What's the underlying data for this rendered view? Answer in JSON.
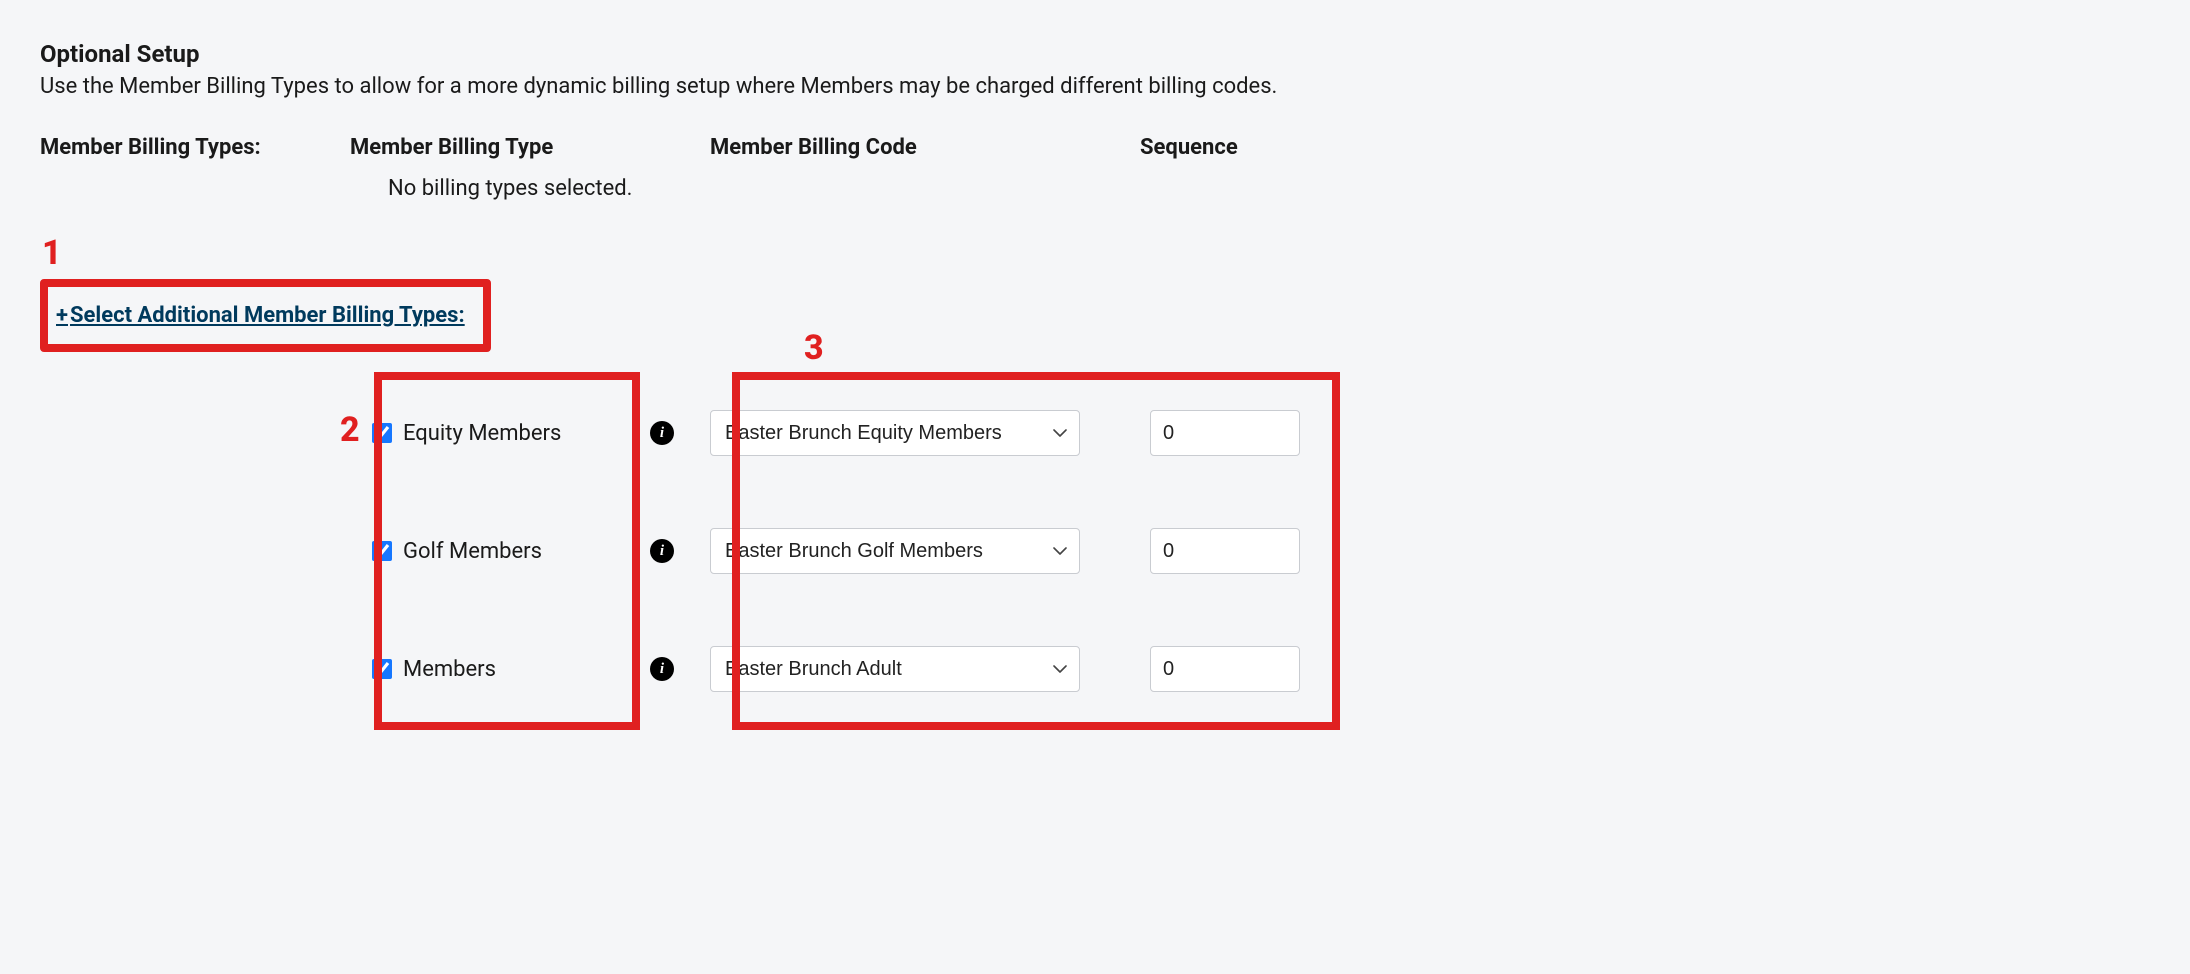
{
  "section": {
    "title": "Optional Setup",
    "description": "Use the Member Billing Types to allow for a more dynamic billing setup where Members may be charged different billing codes."
  },
  "headers": {
    "col1": "Member Billing Types:",
    "col2": "Member Billing Type",
    "col3": "Member Billing Code",
    "col4": "Sequence"
  },
  "empty_message": "No billing types selected.",
  "select_link": {
    "label": "Select Additional Member Billing Types:"
  },
  "annotations": {
    "one": "1",
    "two": "2",
    "three": "3"
  },
  "rows": [
    {
      "checked": true,
      "label": "Equity Members",
      "billing_code": "Easter Brunch Equity Members",
      "sequence": "0"
    },
    {
      "checked": true,
      "label": "Golf Members",
      "billing_code": "Easter Brunch Golf Members",
      "sequence": "0"
    },
    {
      "checked": true,
      "label": "Members",
      "billing_code": "Easter Brunch Adult",
      "sequence": "0"
    }
  ]
}
